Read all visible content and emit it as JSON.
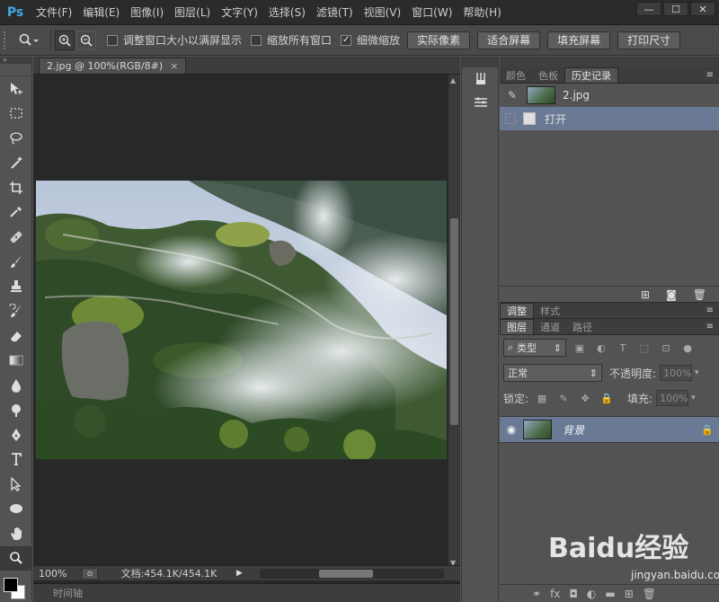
{
  "app": {
    "logo": "Ps",
    "menu": [
      "文件(F)",
      "编辑(E)",
      "图像(I)",
      "图层(L)",
      "文字(Y)",
      "选择(S)",
      "滤镜(T)",
      "视图(V)",
      "窗口(W)",
      "帮助(H)"
    ],
    "window_controls": {
      "minimize": "—",
      "restore": "☐",
      "close": "✕"
    }
  },
  "options_bar": {
    "zoom_in_icon": "magnifier-plus",
    "zoom_out_icon": "magnifier-minus",
    "checkbox_resize": {
      "label": "调整窗口大小以满屏显示",
      "checked": false
    },
    "checkbox_zoom_all": {
      "label": "缩放所有窗口",
      "checked": false
    },
    "checkbox_scrubby": {
      "label": "细微缩放",
      "checked": true
    },
    "buttons": [
      "实际像素",
      "适合屏幕",
      "填充屏幕",
      "打印尺寸"
    ]
  },
  "document": {
    "tab_title": "2.jpg @ 100%(RGB/8#)",
    "tab_close": "×",
    "zoom": "100%",
    "doc_info": "文档:454.1K/454.1K",
    "timeline_label": "时间轴"
  },
  "panels": {
    "top_tabs": [
      "颜色",
      "色板",
      "历史记录"
    ],
    "history": {
      "snapshot_name": "2.jpg",
      "states": [
        "打开"
      ]
    },
    "adjust_tabs": [
      "调整",
      "样式"
    ],
    "layer_tabs": [
      "图层",
      "通道",
      "路径"
    ],
    "layers": {
      "filter_kind": "类型",
      "blend_mode": "正常",
      "opacity_label": "不透明度:",
      "opacity_value": "100%",
      "lock_label": "锁定:",
      "fill_label": "填充:",
      "fill_value": "100%",
      "items": [
        {
          "name": "背景",
          "visible": true,
          "locked": true
        }
      ]
    }
  },
  "watermark": {
    "brand": "Baidu经验",
    "url": "jingyan.baidu.com"
  },
  "colors": {
    "accent": "#41a9e8",
    "selection": "#6a7a95",
    "canvas_bg": "#282828"
  }
}
